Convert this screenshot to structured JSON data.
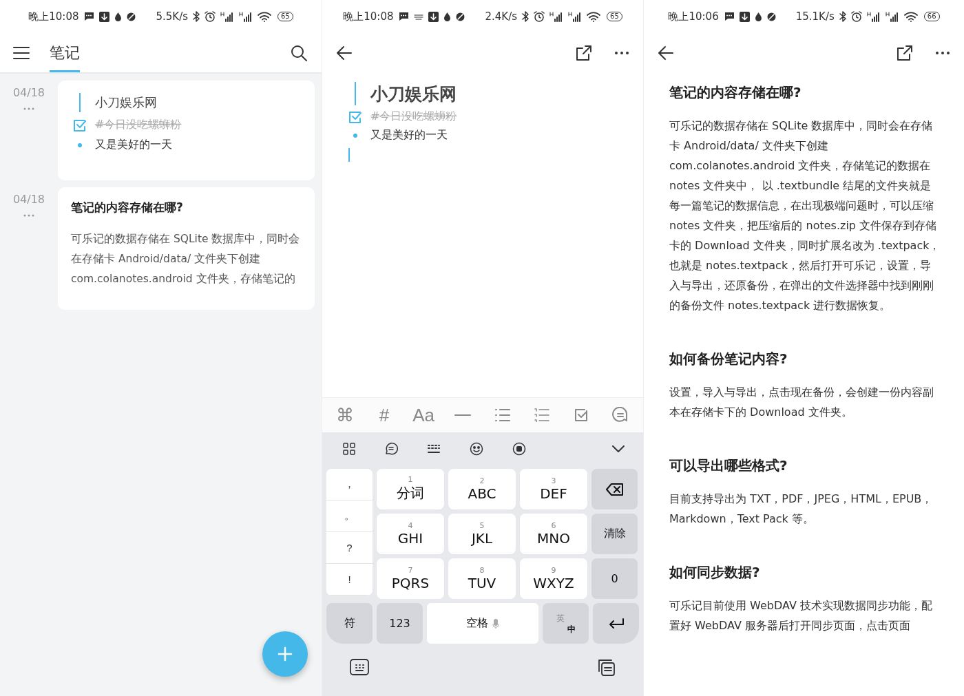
{
  "list_screen": {
    "status_bar": {
      "time": "晚上10:08",
      "speed": "5.5K/s",
      "battery": "65",
      "keyboard_active": false
    },
    "title": "笔记",
    "notes": [
      {
        "date": "04/18",
        "kind": "outline",
        "lines": [
          {
            "kind": "heading",
            "text": "小刀娱乐网"
          },
          {
            "kind": "task",
            "text": "#今日没吃螺蛳粉",
            "checked": true
          },
          {
            "kind": "bullet",
            "text": "又是美好的一天"
          }
        ]
      },
      {
        "date": "04/18",
        "kind": "article",
        "title": "笔记的内容存储在哪?",
        "body": "可乐记的数据存储在 SQLite 数据库中，同时会在存储卡 Android/data/ 文件夹下创建 com.colanotes.android 文件夹，存储笔记的"
      }
    ]
  },
  "editor_screen": {
    "status_bar": {
      "time": "晚上10:08",
      "speed": "2.4K/s",
      "battery": "65",
      "keyboard_active": true
    },
    "lines": [
      {
        "kind": "heading",
        "text": "小刀娱乐网"
      },
      {
        "kind": "task",
        "text": "#今日没吃螺蛳粉",
        "checked": true
      },
      {
        "kind": "bullet",
        "text": "又是美好的一天"
      }
    ],
    "format_toolbar": [
      {
        "kind": "text",
        "text": "⌘"
      },
      {
        "kind": "text",
        "text": "#"
      },
      {
        "kind": "text",
        "text": "Aa"
      },
      {
        "kind": "rule"
      },
      {
        "kind": "bullets"
      },
      {
        "kind": "numbered"
      },
      {
        "kind": "task"
      },
      {
        "kind": "comment"
      }
    ],
    "keyboard": {
      "punctuation": [
        "，",
        "。",
        "?",
        "!"
      ],
      "keys": [
        {
          "number": "1",
          "label": "分词"
        },
        {
          "number": "2",
          "label": "ABC"
        },
        {
          "number": "3",
          "label": "DEF"
        },
        {
          "number": "4",
          "label": "GHI"
        },
        {
          "number": "5",
          "label": "JKL"
        },
        {
          "number": "6",
          "label": "MNO"
        },
        {
          "number": "7",
          "label": "PQRS"
        },
        {
          "number": "8",
          "label": "TUV"
        },
        {
          "number": "9",
          "label": "WXYZ"
        }
      ],
      "side_keys": [
        {
          "kind": "backspace"
        },
        {
          "kind": "text",
          "label": "清除"
        },
        {
          "kind": "text",
          "label": "0"
        }
      ],
      "bottom_row": [
        {
          "kind": "text",
          "label": "符"
        },
        {
          "kind": "text",
          "label": "123"
        },
        {
          "kind": "space",
          "label": "空格"
        },
        {
          "kind": "switch",
          "upper": "英",
          "lower": "中"
        },
        {
          "kind": "enter"
        }
      ]
    }
  },
  "reader_screen": {
    "status_bar": {
      "time": "晚上10:06",
      "speed": "15.1K/s",
      "battery": "66",
      "keyboard_active": false
    },
    "sections": [
      {
        "heading": "笔记的内容存储在哪?",
        "body": "可乐记的数据存储在 SQLite 数据库中，同时会在存储卡 Android/data/ 文件夹下创建 com.colanotes.android 文件夹，存储笔记的数据在 notes 文件夹中， 以 .textbundle 结尾的文件夹就是每一篇笔记的数据信息，在出现极端问题时，可以压缩 notes 文件夹，把压缩后的 notes.zip 文件保存到存储卡的 Download 文件夹，同时扩展名改为 .textpack，也就是 notes.textpack，然后打开可乐记，设置，导入与导出，还原备份，在弹出的文件选择器中找到刚刚的备份文件 notes.textpack 进行数据恢复。"
      },
      {
        "heading": "如何备份笔记内容?",
        "body": "设置，导入与导出，点击现在备份，会创建一份内容副本在存储卡下的 Download 文件夹。"
      },
      {
        "heading": "可以导出哪些格式?",
        "body": "目前支持导出为 TXT，PDF，JPEG，HTML，EPUB，Markdown，Text Pack 等。"
      },
      {
        "heading": "如何同步数据?",
        "body": "可乐记目前使用 WebDAV 技术实现数据同步功能，配置好 WebDAV 服务器后打开同步页面，点击页面"
      }
    ]
  }
}
